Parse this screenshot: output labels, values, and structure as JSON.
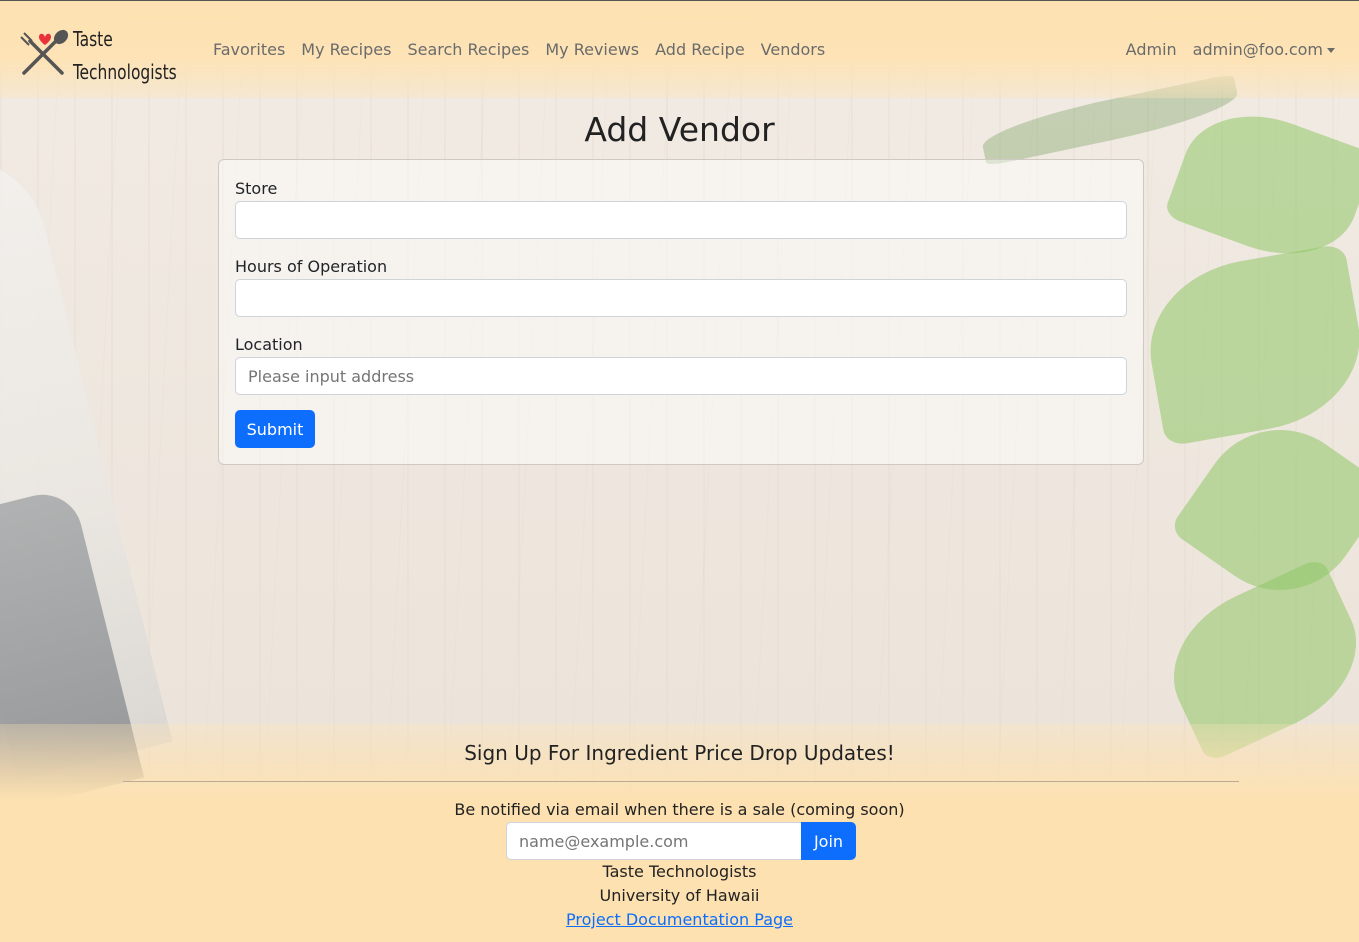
{
  "brand": {
    "line1": "Taste",
    "line2": "Technologists"
  },
  "nav": {
    "links": [
      "Favorites",
      "My Recipes",
      "Search Recipes",
      "My Reviews",
      "Add Recipe",
      "Vendors"
    ],
    "admin": "Admin",
    "user_email": "admin@foo.com"
  },
  "form": {
    "title": "Add Vendor",
    "store_label": "Store",
    "store_value": "",
    "hours_label": "Hours of Operation",
    "hours_value": "",
    "location_label": "Location",
    "location_placeholder": "Please input address",
    "submit_label": "Submit"
  },
  "footer": {
    "heading": "Sign Up For Ingredient Price Drop Updates!",
    "note": "Be notified via email when there is a sale (coming soon)",
    "email_placeholder": "name@example.com",
    "join_label": "Join",
    "org": "Taste Technologists",
    "university": "University of Hawaii",
    "doc_link": "Project Documentation Page"
  },
  "colors": {
    "primary": "#0d6efd",
    "header_bg": "#fde1b1",
    "footer_bg": "#fde1b1"
  }
}
